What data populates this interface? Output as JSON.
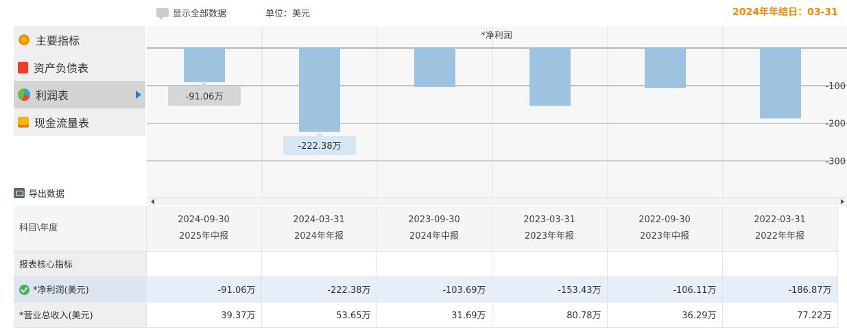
{
  "top": {
    "show_all_label": "显示全部数据",
    "unit_label": "单位：美元",
    "fiscal_label": "2024年年结日：03-31"
  },
  "sidebar": {
    "items": [
      {
        "label": "主要指标",
        "icon": "flower-icon"
      },
      {
        "label": "资产负债表",
        "icon": "document-icon"
      },
      {
        "label": "利润表",
        "icon": "pie-chart-icon",
        "active": true
      },
      {
        "label": "现金流量表",
        "icon": "coins-icon"
      }
    ]
  },
  "export_label": "导出数据",
  "chart_data": {
    "type": "bar",
    "title": "*净利润",
    "categories": [
      "2025年中报",
      "2024年年报",
      "2024年中报",
      "2023年年报",
      "2023年中报",
      "2022年年报"
    ],
    "values": [
      -91.06,
      -222.38,
      -103.69,
      -153.43,
      -106.11,
      -186.87
    ],
    "y_ticks": [
      "-100",
      "-200",
      "-300"
    ],
    "ylim": [
      -390,
      0
    ],
    "grid": true,
    "labels_shown": [
      "-91.06万",
      "-222.38万"
    ],
    "bar_color": "#9dc3e1"
  },
  "table": {
    "header_label": "科目\\年度",
    "columns": [
      {
        "date": "2024-09-30",
        "period": "2025年中报"
      },
      {
        "date": "2024-03-31",
        "period": "2024年年报"
      },
      {
        "date": "2023-09-30",
        "period": "2024年中报"
      },
      {
        "date": "2023-03-31",
        "period": "2023年年报"
      },
      {
        "date": "2022-09-30",
        "period": "2023年中报"
      },
      {
        "date": "2022-03-31",
        "period": "2022年年报"
      }
    ],
    "section_label": "报表核心指标",
    "rows": [
      {
        "label": "*净利润(美元)",
        "values": [
          "-91.06万",
          "-222.38万",
          "-103.69万",
          "-153.43万",
          "-106.11万",
          "-186.87万"
        ]
      },
      {
        "label": "*营业总收入(美元)",
        "values": [
          "39.37万",
          "53.65万",
          "31.69万",
          "80.78万",
          "36.29万",
          "77.22万"
        ]
      }
    ]
  }
}
